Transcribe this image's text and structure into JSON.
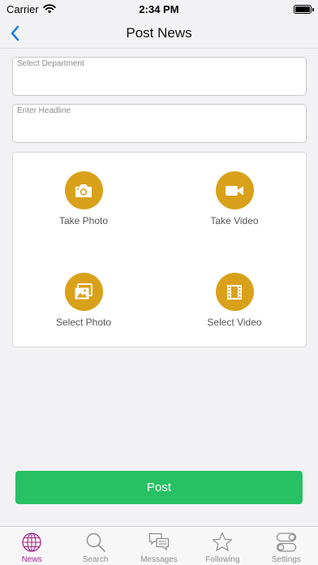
{
  "status_bar": {
    "carrier": "Carrier",
    "time": "2:34 PM"
  },
  "nav": {
    "title": "Post News",
    "back_icon": "chevron-left-icon"
  },
  "form": {
    "department_label": "Select Department",
    "department_value": "",
    "headline_label": "Enter Headline",
    "headline_value": ""
  },
  "media": {
    "take_photo": "Take Photo",
    "take_video": "Take Video",
    "select_photo": "Select Photo",
    "select_video": "Select Video",
    "accent_color": "#d9a11a"
  },
  "post_button": {
    "label": "Post",
    "color": "#28c064"
  },
  "tab_bar": {
    "active_color": "#a0268c",
    "items": [
      {
        "label": "News",
        "icon": "globe-icon",
        "active": true
      },
      {
        "label": "Search",
        "icon": "search-icon",
        "active": false
      },
      {
        "label": "Messages",
        "icon": "chat-bubbles-icon",
        "active": false
      },
      {
        "label": "Following",
        "icon": "star-icon",
        "active": false
      },
      {
        "label": "Settings",
        "icon": "toggles-icon",
        "active": false
      }
    ]
  }
}
